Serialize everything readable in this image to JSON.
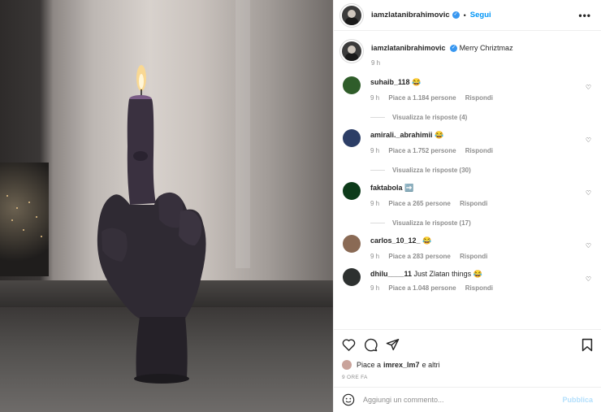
{
  "header": {
    "username": "iamzlatanibrahimovic",
    "separator": "•",
    "follow_label": "Segui",
    "more_label": "•••"
  },
  "caption": {
    "username": "iamzlatanibrahimovic",
    "text": "Merry Chriztmaz",
    "time": "9 h"
  },
  "comments": [
    {
      "username": "suhaib_118",
      "text": "😂",
      "time": "9 h",
      "likes": "Piace a 1.184 persone",
      "reply": "Rispondi",
      "replies": "Visualizza le risposte (4)",
      "avatar_color": "#2f5d2a"
    },
    {
      "username": "amirali._abrahimii",
      "text": "😂",
      "time": "9 h",
      "likes": "Piace a 1.752 persone",
      "reply": "Rispondi",
      "replies": "Visualizza le risposte (30)",
      "avatar_color": "#2c3e66"
    },
    {
      "username": "faktabola",
      "text": "➡️",
      "time": "9 h",
      "likes": "Piace a 265 persone",
      "reply": "Rispondi",
      "replies": "Visualizza le risposte (17)",
      "avatar_color": "#0d3b1a"
    },
    {
      "username": "carlos_10_12_",
      "text": "😂",
      "time": "9 h",
      "likes": "Piace a 283 persone",
      "reply": "Rispondi",
      "replies": "",
      "avatar_color": "#8a6a55"
    },
    {
      "username": "dhilu____11",
      "text": "Just Zlatan things 😂",
      "time": "9 h",
      "likes": "Piace a 1.048 persone",
      "reply": "Rispondi",
      "replies": "",
      "avatar_color": "#2d3130"
    }
  ],
  "likes": {
    "prefix": "Piace a",
    "user": "imrex_lm7",
    "suffix": "e altri"
  },
  "posted_ago": "9 ORE FA",
  "add_comment": {
    "placeholder": "Aggiungi un commento...",
    "publish_label": "Pubblica"
  },
  "colors": {
    "accent": "#0095f6",
    "verified": "#3897f0",
    "muted": "#8e8e8e",
    "publish_disabled": "#b2dffc"
  },
  "icons": {
    "like": "heart-icon",
    "comment": "comment-icon",
    "share": "share-icon",
    "save": "bookmark-icon",
    "emoji": "emoji-icon",
    "verified": "verified-badge-icon"
  }
}
